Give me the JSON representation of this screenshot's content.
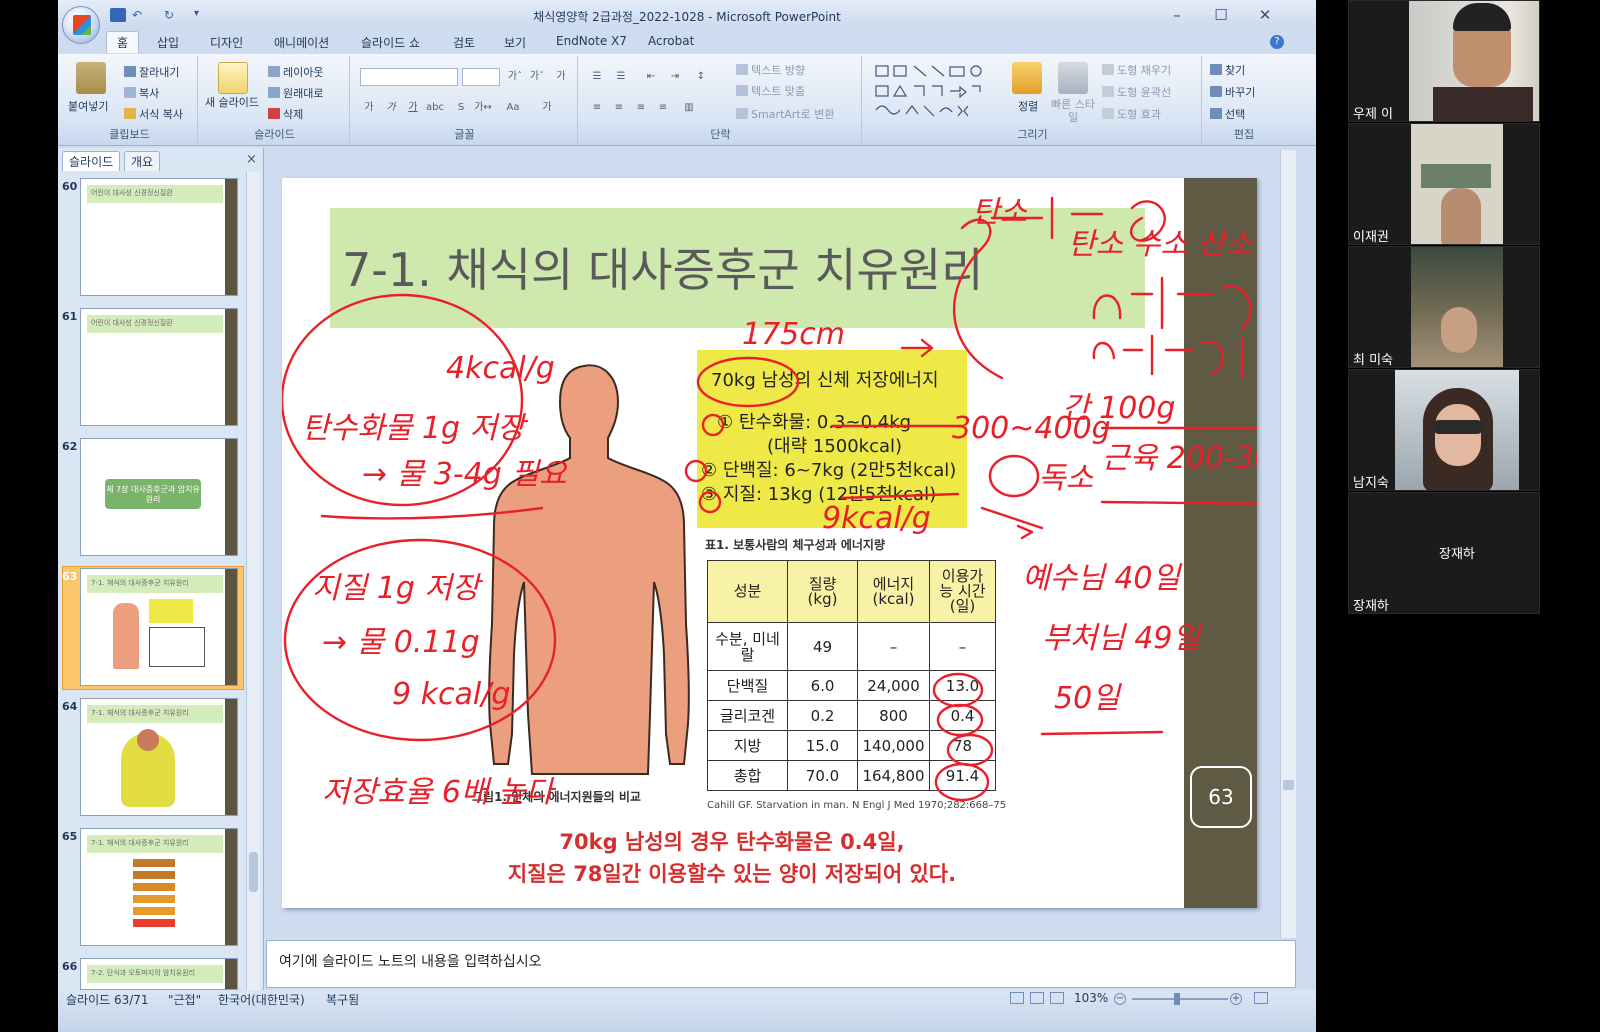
{
  "window": {
    "title": "채식영양학 2급과정_2022-1028 - Microsoft PowerPoint",
    "min": "–",
    "max": "☐",
    "close": "✕"
  },
  "tabs": [
    "홈",
    "삽입",
    "디자인",
    "애니메이션",
    "슬라이드 쇼",
    "검토",
    "보기",
    "EndNote X7",
    "Acrobat"
  ],
  "ribbon": {
    "clipboard": {
      "paste": "붙여넣기",
      "cut": "잘라내기",
      "copy": "복사",
      "format": "서식 복사",
      "label": "클립보드"
    },
    "slides": {
      "new": "새 슬라이드",
      "layout": "레이아웃",
      "reset": "원래대로",
      "delete": "삭제",
      "label": "슬라이드"
    },
    "font": {
      "label": "글꼴",
      "grow": "가ˆ",
      "shrink": "가ˇ",
      "clear": "가",
      "bold": "가",
      "italic": "가",
      "underline": "가",
      "shadow": "S",
      "strike": "abc",
      "spacing": "가↔",
      "case": "Aa",
      "color": "가"
    },
    "para": {
      "label": "단락",
      "direction": "텍스트 방향",
      "align": "텍스트 맞춤",
      "smartart": "SmartArt로 변환"
    },
    "drawing": {
      "label": "그리기",
      "arrange": "정렬",
      "quick": "빠른 스타일",
      "fill": "도형 채우기",
      "outline": "도형 윤곽선",
      "effect": "도형 효과"
    },
    "edit": {
      "label": "편집",
      "find": "찾기",
      "replace": "바꾸기",
      "select": "선택"
    }
  },
  "pane": {
    "tab_slides": "슬라이드",
    "tab_outline": "개요",
    "close": "×",
    "thumbs": [
      {
        "num": "60",
        "title": "어린이 대사성 신경정신질환"
      },
      {
        "num": "61",
        "title": "어린이 대사성 신경정신질환"
      },
      {
        "num": "62",
        "title": "제 7장 대사증후군과 암치유원리"
      },
      {
        "num": "63",
        "title": "7-1. 채식의 대사증후군 치유원리"
      },
      {
        "num": "64",
        "title": "7-1. 채식의 대사증후군 치유원리"
      },
      {
        "num": "65",
        "title": "7-1. 채식의 대사증후군 치유원리"
      },
      {
        "num": "66",
        "title": "7-2. 단식과 오토파지의 암치유원리"
      }
    ]
  },
  "slide": {
    "title": "7-1. 채식의 대사증후군 치유원리",
    "box_title": "70kg 남성의 신체 저장에너지",
    "box_lines": [
      "① 탄수화물: 0.3~0.4kg",
      "(대략 1500kcal)",
      "② 단백질: 6~7kg (2만5천kcal)",
      "③ 지질: 13kg (12만5천kcal)"
    ],
    "table_caption": "표1. 보통사람의 체구성과 에너지량",
    "table_headers": [
      "성분",
      "질량\n(kg)",
      "에너지\n(kcal)",
      "이용가\n능 시간\n(일)"
    ],
    "table_rows": [
      [
        "수분, 미네\n랄",
        "49",
        "–",
        "–"
      ],
      [
        "단백질",
        "6.0",
        "24,000",
        "13.0"
      ],
      [
        "글리코겐",
        "0.2",
        "800",
        "0.4"
      ],
      [
        "지방",
        "15.0",
        "140,000",
        "78"
      ],
      [
        "총합",
        "70.0",
        "164,800",
        "91.4"
      ]
    ],
    "figure_caption": "그림1. 인체의 에너지원들의 비교",
    "source": "Cahill GF. Starvation in man. N Engl J Med 1970;282:668–75",
    "conclusion_1": "70kg 남성의 경우 탄수화물은 0.4일,",
    "conclusion_2": "지질은 78일간 이용할수 있는 양이 저장되어 있다.",
    "page_number": "63",
    "ink_color": "#e8202a"
  },
  "notes_placeholder": "여기에 슬라이드 노트의 내용을 입력하십시오",
  "status": {
    "slide": "슬라이드 63/71",
    "theme": "\"근접\"",
    "lang": "한국어(대한민국)",
    "recovered": "복구됨",
    "zoom": "103%"
  },
  "participants": [
    {
      "name": "우제 이",
      "video": true
    },
    {
      "name": "이재권",
      "video": true
    },
    {
      "name": "최 미숙",
      "video": true
    },
    {
      "name": "남지숙",
      "video": true
    },
    {
      "name": "장재하",
      "video": false,
      "label": "장재하"
    }
  ]
}
